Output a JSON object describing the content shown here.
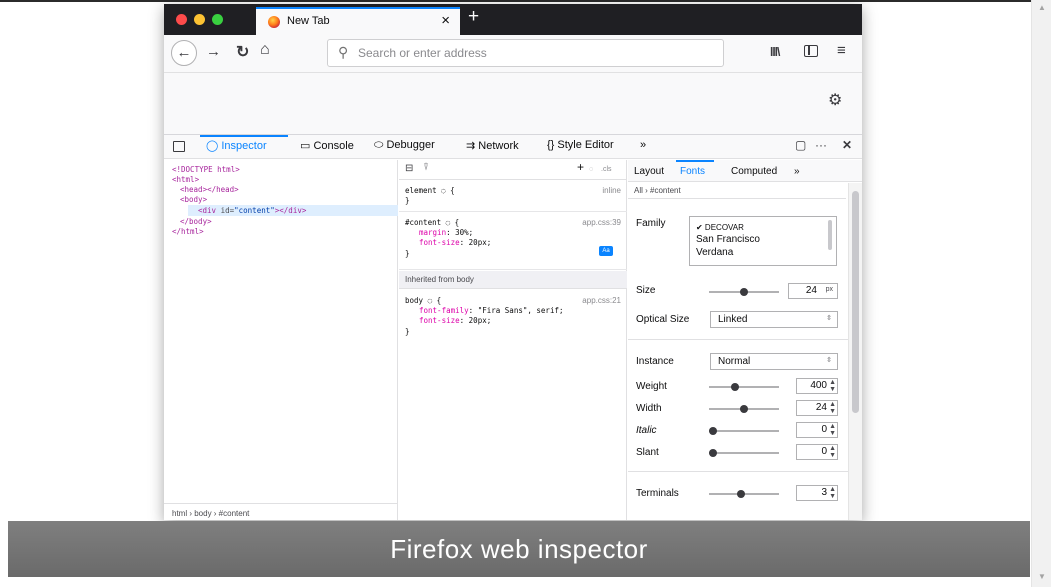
{
  "browser": {
    "tab_title": "New Tab",
    "tab_close": "×",
    "new_tab": "+",
    "url_placeholder": "Search or enter address"
  },
  "devtools": {
    "tabs": [
      "Inspector",
      "Console",
      "Debugger",
      "Network",
      "Style Editor"
    ],
    "overflow": "»",
    "more": "···",
    "close": "✕"
  },
  "markup": {
    "lines": [
      "<!DOCTYPE html>",
      "<html>",
      "<head></head>",
      "<body>",
      "<div id=\"content\"></div>",
      "</body>",
      "</html>"
    ],
    "div_tag_open": "<div",
    "div_attr": "id=",
    "div_val": "\"content\"",
    "div_tag_close": "></div>",
    "breadcrumbs": "html › body › #content"
  },
  "rules": {
    "toolbar_add": "+",
    "toolbar_cls": ".cls",
    "element_selector": "element ◌ {",
    "element_source": "inline",
    "close_brace": "}",
    "content_selector": "#content ◌ {",
    "content_source": "app.css:39",
    "content_decls": [
      {
        "name": "margin",
        "value": "30%;"
      },
      {
        "name": "font-size",
        "value": "20px;"
      }
    ],
    "inherited_label": "Inherited from body",
    "body_selector": "body ◌ {",
    "body_source": "app.css:21",
    "body_decls": [
      {
        "name": "font-family",
        "value": "\"Fira Sans\", serif;"
      },
      {
        "name": "font-size",
        "value": "20px;"
      }
    ],
    "badge": "Aa"
  },
  "side_panel": {
    "tabs": [
      "Layout",
      "Fonts",
      "Computed"
    ],
    "overflow": "»",
    "filter": "All › #content",
    "family_label": "Family",
    "families": [
      "✔ DECOVAR",
      "San Francisco",
      "Verdana"
    ],
    "size_label": "Size",
    "size_value": "24",
    "size_unit": "px",
    "optical_label": "Optical Size",
    "optical_value": "Linked",
    "instance_label": "Instance",
    "instance_value": "Normal",
    "axes": [
      {
        "label": "Weight",
        "value": "400",
        "pos": 0.35
      },
      {
        "label": "Width",
        "value": "24",
        "pos": 0.5
      },
      {
        "label": "Italic",
        "value": "0",
        "pos": 0.0
      },
      {
        "label": "Slant",
        "value": "0",
        "pos": 0.0
      }
    ],
    "size_pos": 0.5,
    "terminals_label": "Terminals",
    "terminals_value": "3",
    "terminals_pos": 0.45
  },
  "caption": "Firefox web inspector"
}
